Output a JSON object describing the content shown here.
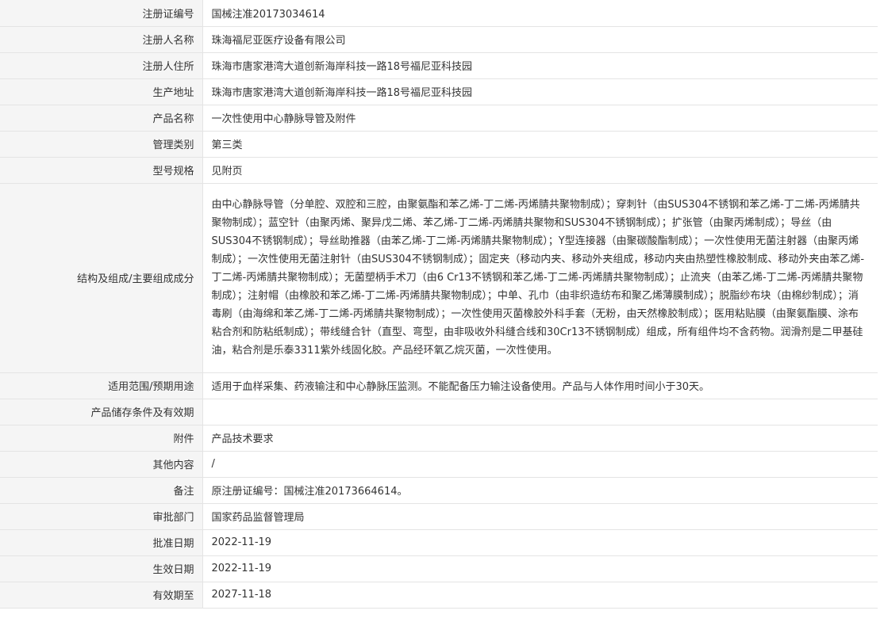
{
  "fields": [
    {
      "label": "注册证编号",
      "value": "国械注准20173034614"
    },
    {
      "label": "注册人名称",
      "value": "珠海福尼亚医疗设备有限公司"
    },
    {
      "label": "注册人住所",
      "value": "珠海市唐家港湾大道创新海岸科技一路18号福尼亚科技园"
    },
    {
      "label": "生产地址",
      "value": "珠海市唐家港湾大道创新海岸科技一路18号福尼亚科技园"
    },
    {
      "label": "产品名称",
      "value": "一次性使用中心静脉导管及附件"
    },
    {
      "label": "管理类别",
      "value": "第三类"
    },
    {
      "label": "型号规格",
      "value": "见附页"
    },
    {
      "label": "结构及组成/主要组成成分",
      "value": "由中心静脉导管（分单腔、双腔和三腔，由聚氨酯和苯乙烯-丁二烯-丙烯腈共聚物制成）；穿刺针（由SUS304不锈钢和苯乙烯-丁二烯-丙烯腈共聚物制成）；蓝空针（由聚丙烯、聚异戊二烯、苯乙烯-丁二烯-丙烯腈共聚物和SUS304不锈钢制成）；扩张管（由聚丙烯制成）；导丝（由SUS304不锈钢制成）；导丝助推器（由苯乙烯-丁二烯-丙烯腈共聚物制成）；Y型连接器（由聚碳酸酯制成）；一次性使用无菌注射器（由聚丙烯制成）；一次性使用无菌注射针（由SUS304不锈钢制成）；固定夹（移动内夹、移动外夹组成，移动内夹由热塑性橡胶制成、移动外夹由苯乙烯-丁二烯-丙烯腈共聚物制成）；无菌塑柄手术刀（由6 Cr13不锈钢和苯乙烯-丁二烯-丙烯腈共聚物制成）；止流夹（由苯乙烯-丁二烯-丙烯腈共聚物制成）；注射帽（由橡胶和苯乙烯-丁二烯-丙烯腈共聚物制成）；中单、孔巾（由非织造纺布和聚乙烯薄膜制成）；脱脂纱布块（由棉纱制成）；消毒刷（由海绵和苯乙烯-丁二烯-丙烯腈共聚物制成）；一次性使用灭菌橡胶外科手套（无粉，由天然橡胶制成）；医用粘贴膜（由聚氨酯膜、涂布粘合剂和防粘纸制成）；带线缝合针（直型、弯型，由非吸收外科缝合线和30Cr13不锈钢制成）组成，所有组件均不含药物。润滑剂是二甲基硅油，粘合剂是乐泰3311紫外线固化胶。产品经环氧乙烷灭菌，一次性使用。"
    },
    {
      "label": "适用范围/预期用途",
      "value": "适用于血样采集、药液输注和中心静脉压监测。不能配备压力输注设备使用。产品与人体作用时间小于30天。"
    },
    {
      "label": "产品储存条件及有效期",
      "value": ""
    },
    {
      "label": "附件",
      "value": "产品技术要求"
    },
    {
      "label": "其他内容",
      "value": "/"
    },
    {
      "label": "备注",
      "value": "原注册证编号：国械注准20173664614。"
    },
    {
      "label": "审批部门",
      "value": "国家药品监督管理局"
    },
    {
      "label": "批准日期",
      "value": "2022-11-19"
    },
    {
      "label": "生效日期",
      "value": "2022-11-19"
    },
    {
      "label": "有效期至",
      "value": "2027-11-18"
    }
  ]
}
